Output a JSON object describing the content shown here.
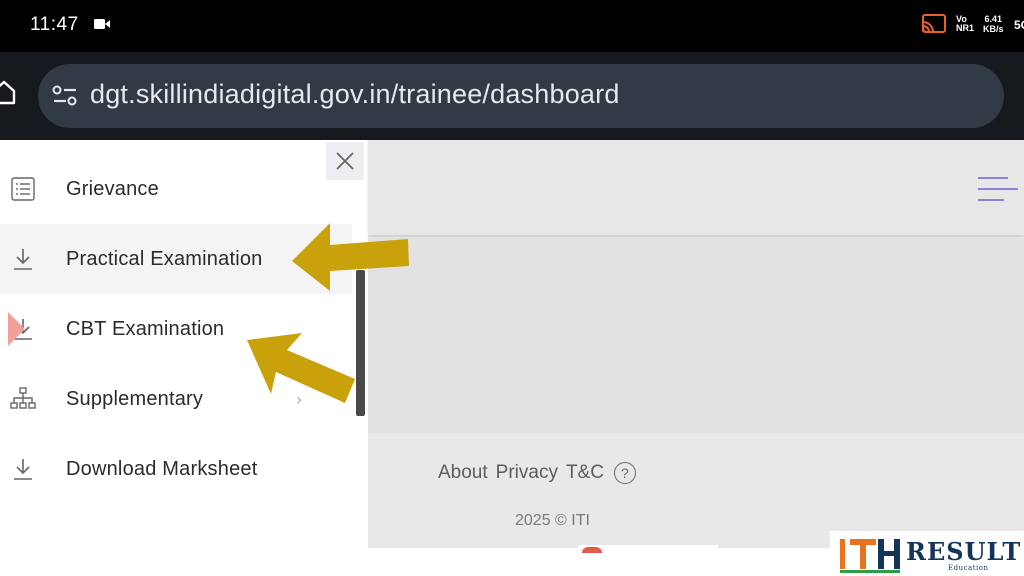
{
  "status_bar": {
    "time": "11:47",
    "volte_top": "Vo",
    "volte_bottom": "NR1",
    "speed_value": "6.41",
    "speed_unit": "KB/s",
    "network": "5G",
    "icons": [
      "video-icon",
      "cast-icon"
    ]
  },
  "browser": {
    "url": "dgt.skillindiadigital.gov.in/trainee/dashboard",
    "icons": [
      "home-icon",
      "site-settings-icon"
    ]
  },
  "drawer": {
    "menu_items": [
      {
        "label": "Grievance",
        "icon": "list-icon",
        "highlighted": false
      },
      {
        "label": "Practical Examination",
        "icon": "download-icon",
        "highlighted": true
      },
      {
        "label": "CBT Examination",
        "icon": "download-icon",
        "highlighted": false
      },
      {
        "label": "Supplementary",
        "icon": "sitemap-icon",
        "highlighted": false,
        "has_submenu": true
      },
      {
        "label": "Download Marksheet",
        "icon": "download-icon",
        "highlighted": false
      }
    ]
  },
  "footer": {
    "links": [
      "About",
      "Privacy",
      "T&C"
    ],
    "help_symbol": "?",
    "copyright": "2025 © ITI"
  },
  "brand": {
    "name": "RESULT",
    "tagline": "Education",
    "colors": {
      "orange": "#e8731e",
      "navy": "#14345a",
      "green": "#2e9b47"
    }
  },
  "annotation_color": "#c9a10b"
}
